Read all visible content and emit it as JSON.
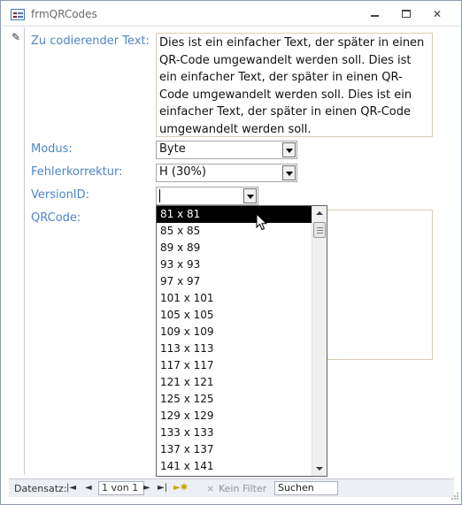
{
  "window": {
    "title": "frmQRCodes"
  },
  "form": {
    "text_label": "Zu codierender Text:",
    "text_value": "Dies ist ein einfacher Text, der später in einen QR-Code umgewandelt werden soll. Dies ist ein einfacher Text, der später in einen QR-Code umgewandelt werden soll. Dies ist ein einfacher Text, der später in einen QR-Code umgewandelt werden soll.",
    "modus_label": "Modus:",
    "modus_value": "Byte",
    "fehler_label": "Fehlerkorrektur:",
    "fehler_value": "H (30%)",
    "version_label": "VersionID:",
    "version_value": "",
    "qrcode_label": "QRCode:"
  },
  "dropdown": {
    "selected": "81 x 81",
    "items": [
      "81 x 81",
      "85 x 85",
      "89 x 89",
      "93 x 93",
      "97 x 97",
      "101 x 101",
      "105 x 105",
      "109 x 109",
      "113 x 113",
      "117 x 117",
      "121 x 121",
      "125 x 125",
      "129 x 129",
      "133 x 133",
      "137 x 137",
      "141 x 141"
    ]
  },
  "navbar": {
    "label": "Datensatz:",
    "record": "1 von 1",
    "filter": "Kein Filter",
    "search": "Suchen"
  },
  "icons": {
    "app": "form-icon",
    "pencil": "pencil-icon",
    "cursor": "mouse-pointer-icon"
  }
}
